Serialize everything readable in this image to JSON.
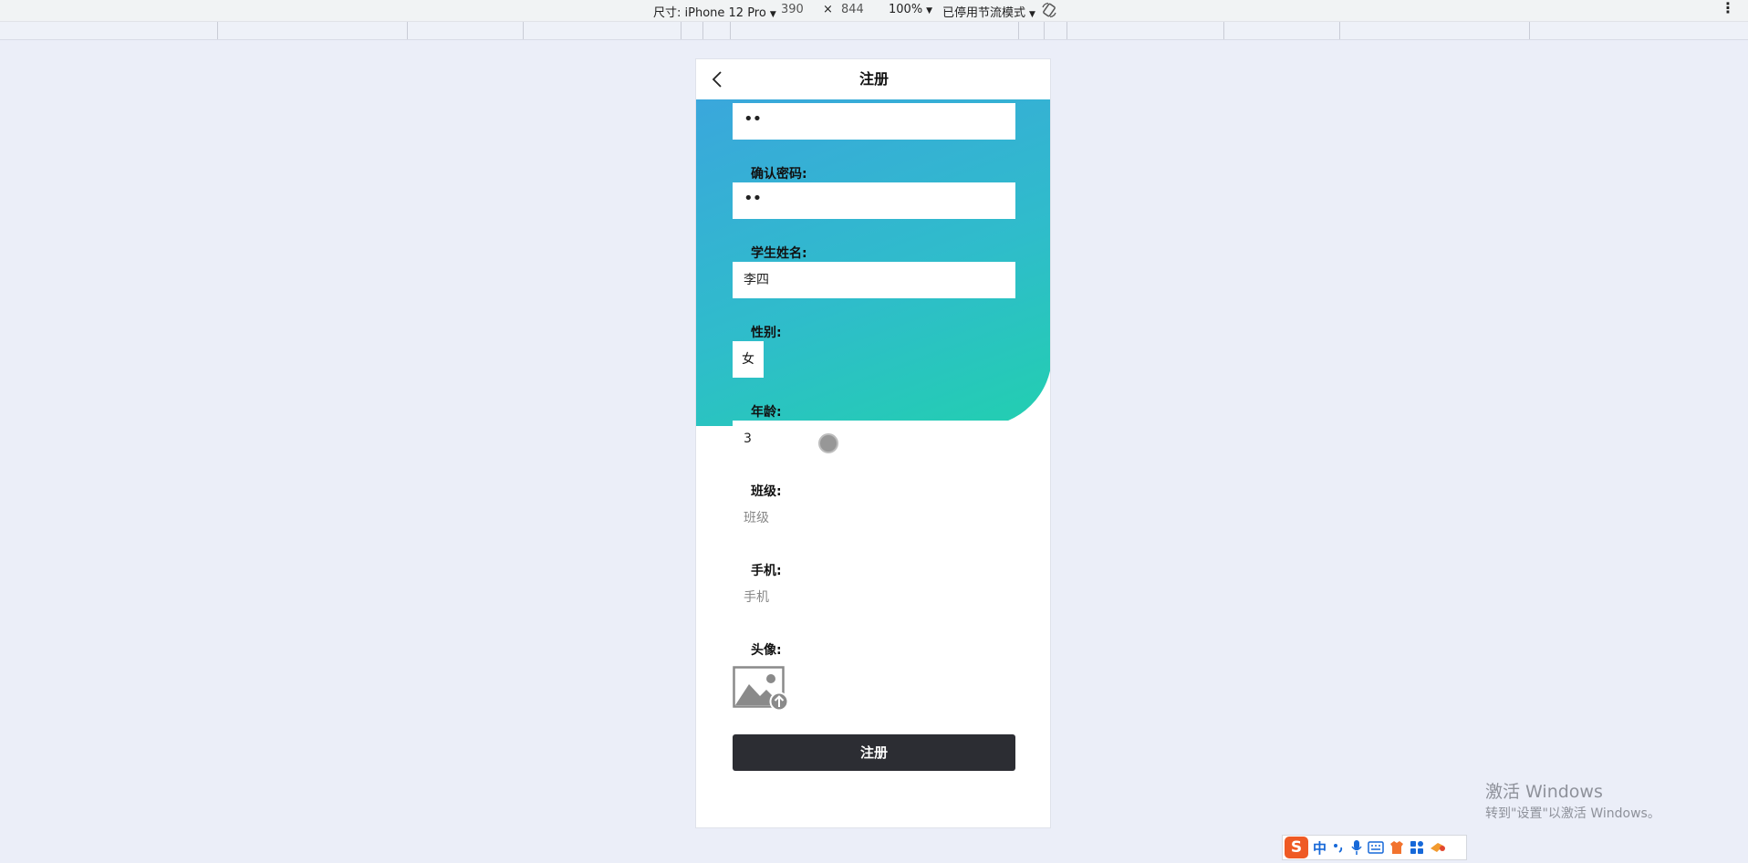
{
  "devtools": {
    "size_label": "尺寸: iPhone 12 Pro",
    "width": "390",
    "times": "×",
    "height": "844",
    "zoom": "100%",
    "throttle": "已停用节流模式"
  },
  "page": {
    "title": "注册",
    "fields": {
      "password_value": "••",
      "confirm_label": "确认密码:",
      "confirm_value": "••",
      "name_label": "学生姓名:",
      "name_value": "李四",
      "gender_label": "性别:",
      "gender_value": "女",
      "age_label": "年龄:",
      "age_value": "3",
      "class_label": "班级:",
      "class_placeholder": "班级",
      "phone_label": "手机:",
      "phone_placeholder": "手机",
      "avatar_label": "头像:"
    },
    "submit_label": "注册"
  },
  "windows": {
    "activate_title": "激活 Windows",
    "activate_sub": "转到\"设置\"以激活 Windows。"
  },
  "ime": {
    "logo": "S",
    "lang": "中",
    "icons": [
      "punctuation-icon",
      "microphone-icon",
      "keyboard-icon",
      "skin-icon",
      "apps-icon",
      "toolbox-icon"
    ]
  },
  "colors": {
    "hero_gradient_start": "#3aa7dc",
    "hero_gradient_end": "#22cfb0",
    "submit_button": "#2c2d33",
    "ime_accent": "#ef5a24"
  }
}
